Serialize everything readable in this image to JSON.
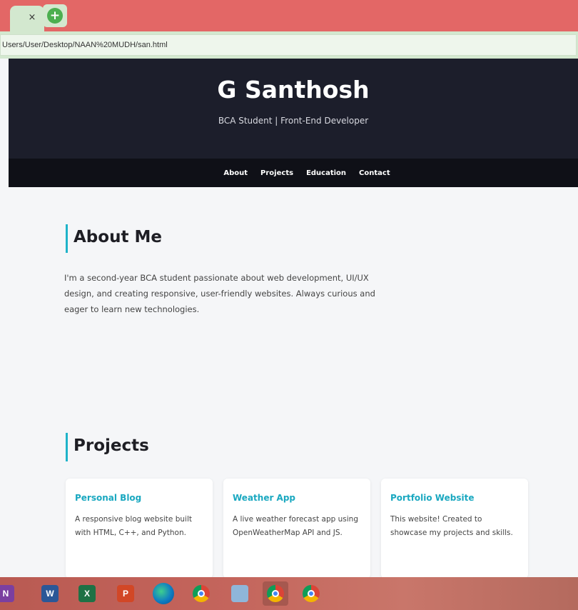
{
  "browser": {
    "tab_close_glyph": "×",
    "new_tab_glyph": "+",
    "url": "Users/User/Desktop/NAAN%20MUDH/san.html"
  },
  "header": {
    "name": "G Santhosh",
    "tagline": "BCA Student | Front-End Developer"
  },
  "nav": {
    "items": [
      "About",
      "Projects",
      "Education",
      "Contact"
    ]
  },
  "about": {
    "title": "About Me",
    "body": "I'm a second-year BCA student passionate about web development, UI/UX design, and creating responsive, user-friendly websites. Always curious and eager to learn new technologies."
  },
  "projects": {
    "title": "Projects",
    "cards": [
      {
        "title": "Personal Blog",
        "description": "A responsive blog website built with HTML, C++, and Python."
      },
      {
        "title": "Weather App",
        "description": "A live weather forecast app using OpenWeatherMap API and JS."
      },
      {
        "title": "Portfolio Website",
        "description": "This website! Created to showcase my projects and skills."
      }
    ]
  },
  "colors": {
    "tab_strip": "#e36766",
    "header_bg": "#1c1e2b",
    "nav_bg": "#0f1017",
    "accent": "#1fb3c9"
  },
  "taskbar": {
    "icons": [
      {
        "name": "onenote-icon",
        "glyph": "N"
      },
      {
        "name": "word-icon",
        "glyph": "W"
      },
      {
        "name": "excel-icon",
        "glyph": "X"
      },
      {
        "name": "powerpoint-icon",
        "glyph": "P"
      },
      {
        "name": "edge-icon",
        "glyph": ""
      },
      {
        "name": "chrome-icon",
        "glyph": ""
      },
      {
        "name": "notepad-icon",
        "glyph": ""
      },
      {
        "name": "chrome-active-icon",
        "glyph": ""
      },
      {
        "name": "chrome-profile-icon",
        "glyph": ""
      }
    ]
  }
}
